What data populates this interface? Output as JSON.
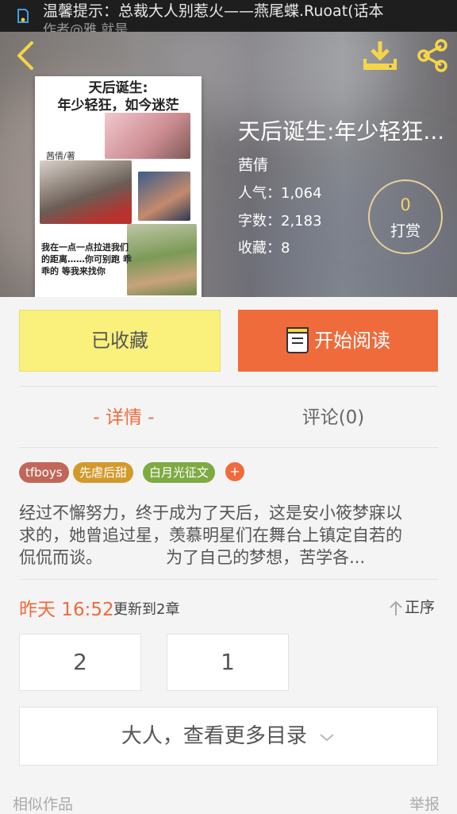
{
  "status_bar": {
    "marquee": "温馨提示：总裁大人别惹火——燕尾蝶.Ruoat(话本",
    "marquee_sub": "作者@雅 就是"
  },
  "book": {
    "title": "天后诞生:年少轻狂...",
    "author": "茜倩",
    "popularity_label": "人气：",
    "popularity": "1,064",
    "words_label": "字数：",
    "words": "2,183",
    "favorites_label": "收藏：",
    "favorites": "8",
    "reward_count": "0",
    "reward_label": "打赏"
  },
  "cover": {
    "title_line1": "天后诞生:",
    "title_line2": "年少轻狂，如今迷茫",
    "author": "茜倩/著",
    "quote": "我在一点一点拉进我们的距离……你可别跑 乖乖的 等我来找你"
  },
  "actions": {
    "collect": "已收藏",
    "read": "开始阅读"
  },
  "tabs": {
    "detail": "- 详情 -",
    "comments": "评论(0)"
  },
  "tags": [
    {
      "label": "tfboys",
      "color": "#c0675a"
    },
    {
      "label": "先虐后甜",
      "color": "#d29a2c"
    },
    {
      "label": "白月光征文",
      "color": "#7eaa42"
    }
  ],
  "tag_add": "+",
  "synopsis": {
    "line1": "经过不懈努力，终于成为了天后，这是安小筱梦寐以",
    "line2": "求的，她曾追过星，羡慕明星们在舞台上镇定自若的",
    "line3": "侃侃而谈。            为了自己的梦想，苦学各..."
  },
  "update": {
    "time": "昨天 16:52",
    "info": "更新到2章",
    "sort": "正序"
  },
  "chapters": [
    "2",
    "1"
  ],
  "more_toc": "大人，查看更多目录",
  "footer": {
    "similar": "相似作品",
    "report": "举报"
  },
  "colors": {
    "accent": "#ef6b3c",
    "collect_bg": "#faf07c",
    "icon_yellow": "#f5d54a"
  }
}
